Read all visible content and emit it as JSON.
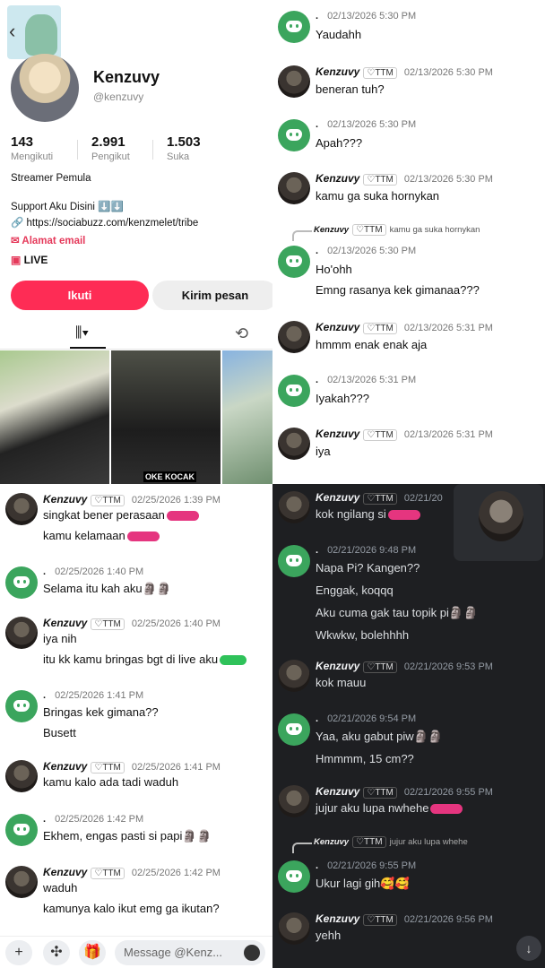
{
  "profile": {
    "name": "Kenzuvy",
    "handle": "@kenzuvy",
    "stats": [
      {
        "num": "143",
        "label": "Mengikuti"
      },
      {
        "num": "2.991",
        "label": "Pengikut"
      },
      {
        "num": "1.503",
        "label": "Suka"
      }
    ],
    "bio1": "Streamer Pemula",
    "bio2": "Support Aku Disini ⬇️⬇️",
    "link": "https://sociabuzz.com/kenzmelet/tribe",
    "email": "Alamat email",
    "live": "LIVE",
    "follow": "Ikuti",
    "message": "Kirim pesan",
    "thumb_caption": "OKE KOCAK"
  },
  "chat_tr": [
    {
      "who": "discord",
      "name": ".",
      "time": "02/13/2026 5:30 PM",
      "lines": [
        "Yaudahh"
      ]
    },
    {
      "who": "kz",
      "name": "Kenzuvy",
      "tag": "♡TTM",
      "time": "02/13/2026 5:30 PM",
      "lines": [
        "beneran tuh?"
      ]
    },
    {
      "who": "discord",
      "name": ".",
      "time": "02/13/2026 5:30 PM",
      "lines": [
        "Apah???"
      ]
    },
    {
      "who": "kz",
      "name": "Kenzuvy",
      "tag": "♡TTM",
      "time": "02/13/2026 5:30 PM",
      "lines": [
        "kamu ga suka hornykan"
      ]
    },
    {
      "who": "discord",
      "name": ".",
      "time": "02/13/2026 5:30 PM",
      "lines": [
        "Ho'ohh",
        "Emng rasanya kek gimanaa???"
      ],
      "reply": {
        "name": "Kenzuvy",
        "tag": "♡TTM",
        "text": "kamu ga suka hornykan"
      }
    },
    {
      "who": "kz",
      "name": "Kenzuvy",
      "tag": "♡TTM",
      "time": "02/13/2026 5:31 PM",
      "lines": [
        "hmmm enak enak aja"
      ]
    },
    {
      "who": "discord",
      "name": ".",
      "time": "02/13/2026 5:31 PM",
      "lines": [
        "Iyakah???"
      ]
    },
    {
      "who": "kz",
      "name": "Kenzuvy",
      "tag": "♡TTM",
      "time": "02/13/2026 5:31 PM",
      "lines": [
        "iya"
      ]
    }
  ],
  "chat_bl": [
    {
      "who": "kz",
      "name": "Kenzuvy",
      "tag": "♡TTM",
      "time": "02/25/2026 1:39 PM",
      "lines": [
        "singkat bener perasaan",
        "kamu kelamaan"
      ]
    },
    {
      "who": "discord",
      "name": ".",
      "time": "02/25/2026 1:40 PM",
      "lines": [
        "Selama itu kah aku🗿🗿"
      ]
    },
    {
      "who": "kz",
      "name": "Kenzuvy",
      "tag": "♡TTM",
      "time": "02/25/2026 1:40 PM",
      "lines": [
        "iya nih",
        "itu kk kamu bringas bgt di live aku"
      ]
    },
    {
      "who": "discord",
      "name": ".",
      "time": "02/25/2026 1:41 PM",
      "lines": [
        "Bringas kek gimana??",
        "Busett"
      ]
    },
    {
      "who": "kz",
      "name": "Kenzuvy",
      "tag": "♡TTM",
      "time": "02/25/2026 1:41 PM",
      "lines": [
        "kamu kalo ada tadi waduh"
      ]
    },
    {
      "who": "discord",
      "name": ".",
      "time": "02/25/2026 1:42 PM",
      "lines": [
        "Ekhem, engas pasti si papi🗿🗿"
      ]
    },
    {
      "who": "kz",
      "name": "Kenzuvy",
      "tag": "♡TTM",
      "time": "02/25/2026 1:42 PM",
      "lines": [
        "waduh",
        "kamunya kalo ikut emg ga ikutan?"
      ]
    }
  ],
  "input_placeholder": "Message @Kenz...",
  "chat_br": [
    {
      "who": "kz",
      "name": "Kenzuvy",
      "tag": "♡TTM",
      "time": "02/21/20",
      "lines": [
        "kok ngilang si"
      ]
    },
    {
      "who": "discord",
      "name": ".",
      "time": "02/21/2026 9:48 PM",
      "lines": [
        "Napa Pi? Kangen??",
        "Enggak, koqqq",
        "Aku cuma gak tau topik pi🗿🗿",
        "Wkwkw, bolehhhh"
      ]
    },
    {
      "who": "kz",
      "name": "Kenzuvy",
      "tag": "♡TTM",
      "time": "02/21/2026 9:53 PM",
      "lines": [
        "kok mauu"
      ]
    },
    {
      "who": "discord",
      "name": ".",
      "time": "02/21/2026 9:54 PM",
      "lines": [
        "Yaa, aku gabut piw🗿🗿",
        "Hmmmm, 15 cm??"
      ]
    },
    {
      "who": "kz",
      "name": "Kenzuvy",
      "tag": "♡TTM",
      "time": "02/21/2026 9:55 PM",
      "lines": [
        "jujur aku lupa nwhehe"
      ]
    },
    {
      "who": "discord",
      "name": ".",
      "time": "02/21/2026 9:55 PM",
      "lines": [
        "Ukur lagi gih🥰🥰"
      ],
      "reply": {
        "name": "Kenzuvy",
        "tag": "♡TTM",
        "text": "jujur aku lupa whehe"
      }
    },
    {
      "who": "kz",
      "name": "Kenzuvy",
      "tag": "♡TTM",
      "time": "02/21/2026 9:56 PM",
      "lines": [
        "yehh"
      ]
    }
  ]
}
